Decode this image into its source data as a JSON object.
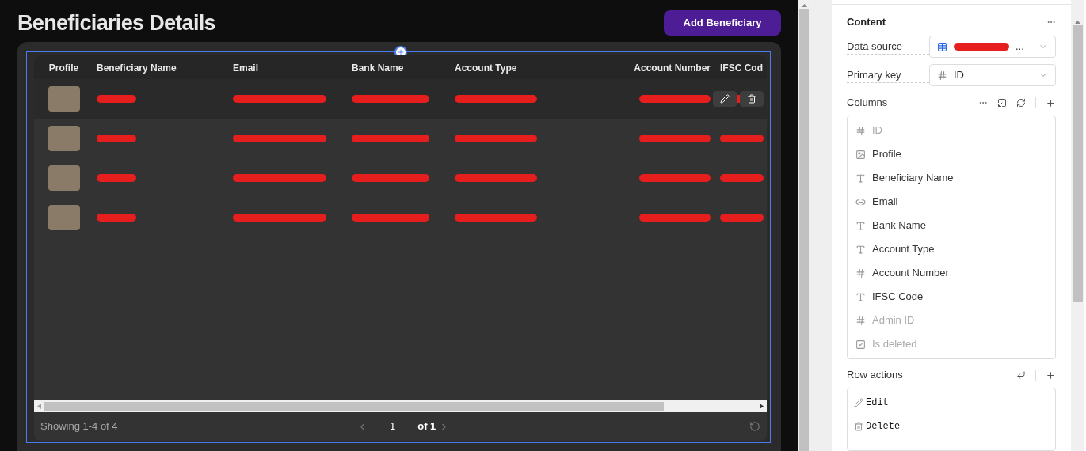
{
  "page": {
    "title": "Beneficiaries Details",
    "add_button": "Add Beneficiary"
  },
  "table": {
    "columns": [
      "Profile",
      "Beneficiary Name",
      "Email",
      "Bank Name",
      "Account Type",
      "Account Number",
      "IFSC Cod"
    ],
    "rows": [
      {
        "redacted": true,
        "hovered": true
      },
      {
        "redacted": true,
        "hovered": false
      },
      {
        "redacted": true,
        "hovered": false
      },
      {
        "redacted": true,
        "hovered": false
      }
    ],
    "footer": {
      "showing": "Showing 1-4 of 4",
      "page": "1",
      "of": "of 1"
    }
  },
  "panel": {
    "section": "Content",
    "data_source": {
      "label": "Data source",
      "redacted": true,
      "value": "..."
    },
    "primary_key": {
      "label": "Primary key",
      "value": "ID"
    },
    "columns_label": "Columns",
    "columns": [
      {
        "kind": "number",
        "label": "ID",
        "hidden": true
      },
      {
        "kind": "image",
        "label": "Profile",
        "hidden": false
      },
      {
        "kind": "text",
        "label": "Beneficiary Name",
        "hidden": false
      },
      {
        "kind": "link",
        "label": "Email",
        "hidden": false
      },
      {
        "kind": "text",
        "label": "Bank Name",
        "hidden": false
      },
      {
        "kind": "text",
        "label": "Account Type",
        "hidden": false
      },
      {
        "kind": "number",
        "label": "Account Number",
        "hidden": false
      },
      {
        "kind": "text",
        "label": "IFSC Code",
        "hidden": false
      },
      {
        "kind": "number",
        "label": "Admin ID",
        "hidden": true
      },
      {
        "kind": "checkbox",
        "label": "Is deleted",
        "hidden": true
      }
    ],
    "row_actions_label": "Row actions",
    "row_actions": [
      {
        "kind": "edit",
        "label": "Edit"
      },
      {
        "kind": "delete",
        "label": "Delete"
      }
    ]
  }
}
